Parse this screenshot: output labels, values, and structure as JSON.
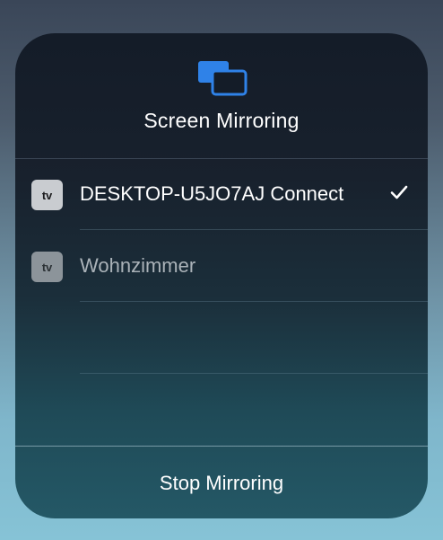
{
  "panel": {
    "title": "Screen Mirroring",
    "icon": "screen-mirroring-icon",
    "accent_color": "#2f82e8"
  },
  "devices": [
    {
      "badge_label": "tv",
      "badge_icon": "apple-tv-icon",
      "name": "DESKTOP-U5JO7AJ Connect",
      "selected": true,
      "status_icon": "checkmark-icon"
    },
    {
      "badge_label": "tv",
      "badge_icon": "apple-tv-icon",
      "name": "Wohnzimmer",
      "selected": false
    }
  ],
  "footer": {
    "stop_label": "Stop Mirroring"
  }
}
